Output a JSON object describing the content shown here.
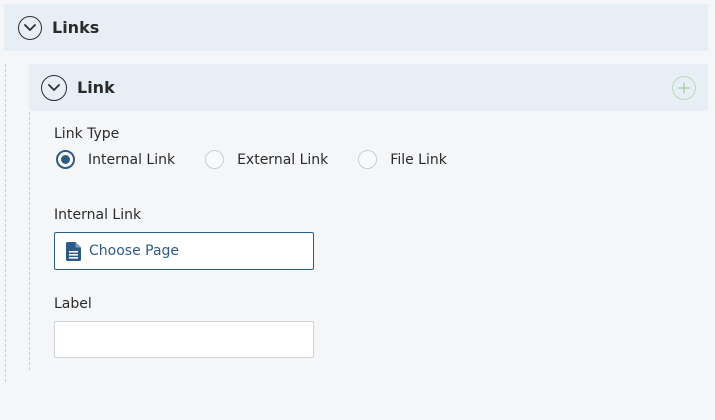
{
  "section": {
    "title": "Links",
    "toggle_icon": "chevron-down-icon"
  },
  "item": {
    "title": "Link",
    "toggle_icon": "chevron-down-icon",
    "add_icon": "plus-icon"
  },
  "link_type": {
    "label": "Link Type",
    "options": [
      {
        "label": "Internal Link",
        "checked": true
      },
      {
        "label": "External Link",
        "checked": false
      },
      {
        "label": "File Link",
        "checked": false
      }
    ]
  },
  "internal_link": {
    "label": "Internal Link",
    "button_label": "Choose Page",
    "icon": "document-icon"
  },
  "label_field": {
    "label": "Label",
    "value": "",
    "placeholder": ""
  },
  "colors": {
    "accent": "#2d5b87",
    "header_bg": "#e8eef5",
    "add": "#b8dcb8"
  }
}
